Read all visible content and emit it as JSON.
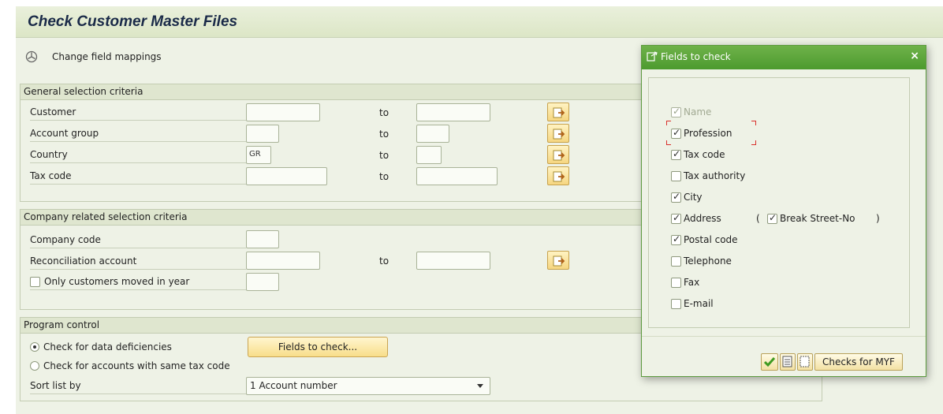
{
  "header": {
    "title": "Check Customer Master Files"
  },
  "toolbar": {
    "change_mappings_icon": "cube-icon",
    "change_mappings_label": "Change field mappings"
  },
  "general": {
    "title": "General selection criteria",
    "to_label": "to",
    "rows": [
      {
        "label": "Customer",
        "from": "",
        "to": ""
      },
      {
        "label": "Account group",
        "from": "",
        "to": ""
      },
      {
        "label": "Country",
        "from": "GR",
        "to": ""
      },
      {
        "label": "Tax code",
        "from": "",
        "to": ""
      }
    ]
  },
  "company": {
    "title": "Company related selection criteria",
    "rows": [
      {
        "label": "Company code",
        "from": ""
      },
      {
        "label": "Reconciliation account",
        "from": "",
        "to": ""
      }
    ],
    "moved_checkbox": {
      "label": "Only customers moved in year",
      "checked": false,
      "value": ""
    }
  },
  "program": {
    "title": "Program control",
    "radio1": {
      "label": "Check for data deficiencies",
      "selected": true
    },
    "radio2": {
      "label": "Check for accounts with same tax code",
      "selected": false
    },
    "fields_button": "Fields to check...",
    "sort_label": "Sort list by",
    "sort_value": "1 Account number"
  },
  "dialog": {
    "title": "Fields to check",
    "close": "×",
    "items": [
      {
        "label": "Name",
        "checked": true,
        "disabled": true
      },
      {
        "label": "Profession",
        "checked": true
      },
      {
        "label": "Tax code",
        "checked": true
      },
      {
        "label": "Tax authority",
        "checked": false
      },
      {
        "label": "City",
        "checked": true
      },
      {
        "label": "Address",
        "checked": true
      },
      {
        "label": "Postal code",
        "checked": true
      },
      {
        "label": "Telephone",
        "checked": false
      },
      {
        "label": "Fax",
        "checked": false
      },
      {
        "label": "E-mail",
        "checked": false
      }
    ],
    "break_open": "(",
    "break_label": "Break Street-No",
    "break_close": ")",
    "checks_myf": "Checks for MYF"
  },
  "colors": {
    "dialog_title": "#4c9a2e",
    "background": "#eef2e6",
    "button_yellow": "#f8de8a"
  }
}
